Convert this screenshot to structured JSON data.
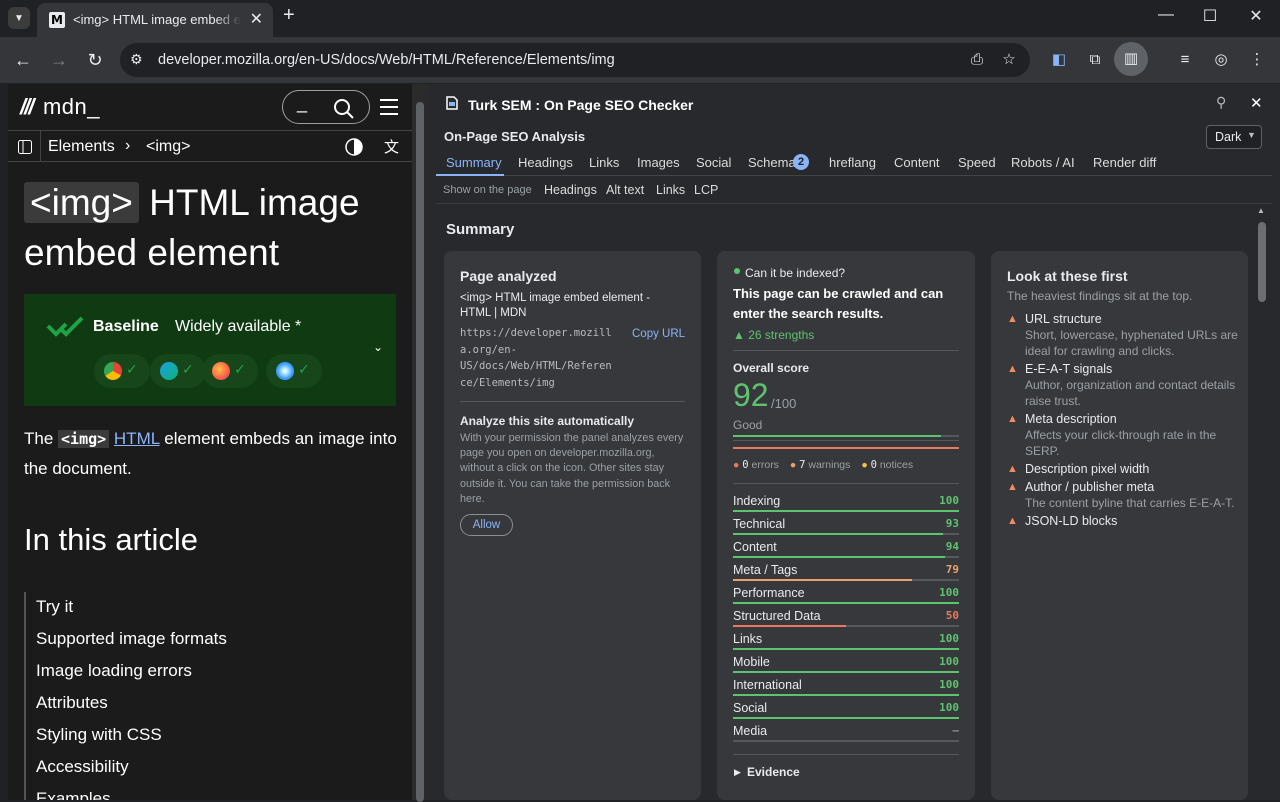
{
  "browser": {
    "tab_title": "<img> HTML image embed element",
    "favicon_letter": "M",
    "url": "developer.mozilla.org/en-US/docs/Web/HTML/Reference/Elements/img"
  },
  "mdn": {
    "logo": "mdn_",
    "breadcrumb": [
      "Elements",
      "<img>"
    ],
    "title_code": "<img>",
    "title_rest": " HTML image embed element",
    "baseline_label": "Baseline",
    "baseline_status": "Widely available *",
    "intro_pre": "The ",
    "intro_code": "<img>",
    "intro_link": "HTML",
    "intro_post": " element embeds an image into the document.",
    "toc_heading": "In this article",
    "toc_items": [
      "Try it",
      "Supported image formats",
      "Image loading errors",
      "Attributes",
      "Styling with CSS",
      "Accessibility",
      "Examples"
    ]
  },
  "panel": {
    "title": "Turk SEM : On Page SEO Checker",
    "subtitle": "On-Page SEO Analysis",
    "theme_select": "Dark",
    "tabs": [
      "Summary",
      "Headings",
      "Links",
      "Images",
      "Social",
      "Schema",
      "hreflang",
      "Content",
      "Speed",
      "Robots / AI",
      "Render diff"
    ],
    "schema_badge": "2",
    "subrow_label": "Show on the page",
    "subrow_items": [
      "Headings",
      "Alt text",
      "Links",
      "LCP"
    ],
    "section_title": "Summary",
    "page_analyzed": {
      "title": "Page analyzed",
      "page_title": "<img> HTML image embed element - HTML | MDN",
      "url": "https://developer.mozilla.org/en-US/docs/Web/HTML/Reference/Elements/img",
      "url_lines": [
        "https://developer.mozill",
        "a.org/en-",
        "US/docs/Web/HTML/Referen",
        "ce/Elements/img"
      ],
      "copy_label": "Copy URL",
      "auto_title": "Analyze this site automatically",
      "auto_desc": "With your permission the panel analyzes every page you open on developer.mozilla.org, without a click on the icon. Other sites stay outside it. You can take the permission back here.",
      "allow_label": "Allow"
    },
    "indexing": {
      "question": "Can it be indexed?",
      "answer": "This page can be crawled and can enter the search results.",
      "strengths": "▲ 26 strengths",
      "score_label": "Overall score",
      "score": "92",
      "score_max": "/100",
      "score_fraction": 0.92,
      "score_word": "Good",
      "errors": "0",
      "errors_label": "errors",
      "warnings": "7",
      "warnings_label": "warnings",
      "notices": "0",
      "notices_label": "notices",
      "metrics": [
        {
          "label": "Indexing",
          "value": "100",
          "pct": 100,
          "color": "#5ec36f"
        },
        {
          "label": "Technical",
          "value": "93",
          "pct": 93,
          "color": "#5ec36f"
        },
        {
          "label": "Content",
          "value": "94",
          "pct": 94,
          "color": "#5ec36f"
        },
        {
          "label": "Meta / Tags",
          "value": "79",
          "pct": 79,
          "color": "#e9a06c"
        },
        {
          "label": "Performance",
          "value": "100",
          "pct": 100,
          "color": "#5ec36f"
        },
        {
          "label": "Structured Data",
          "value": "50",
          "pct": 50,
          "color": "#e9795f"
        },
        {
          "label": "Links",
          "value": "100",
          "pct": 100,
          "color": "#5ec36f"
        },
        {
          "label": "Mobile",
          "value": "100",
          "pct": 100,
          "color": "#5ec36f"
        },
        {
          "label": "International",
          "value": "100",
          "pct": 100,
          "color": "#5ec36f"
        },
        {
          "label": "Social",
          "value": "100",
          "pct": 100,
          "color": "#5ec36f"
        },
        {
          "label": "Media",
          "value": "–",
          "pct": 0,
          "color": "#8a8d91"
        }
      ],
      "evidence": "Evidence"
    },
    "look_first": {
      "title": "Look at these first",
      "subtitle": "The heaviest findings sit at the top.",
      "items": [
        {
          "label": "URL structure",
          "desc": "Short, lowercase, hyphenated URLs are ideal for crawling and clicks."
        },
        {
          "label": "E-E-A-T signals",
          "desc": "Author, organization and contact details raise trust."
        },
        {
          "label": "Meta description",
          "desc": "Affects your click-through rate in the SERP."
        },
        {
          "label": "Description pixel width",
          "desc": ""
        },
        {
          "label": "Author / publisher meta",
          "desc": "The content byline that carries E-E-A-T."
        },
        {
          "label": "JSON-LD blocks",
          "desc": ""
        }
      ]
    }
  },
  "colors": {
    "accent": "#8ab4f8",
    "good": "#5ec36f",
    "warn": "#e9a06c",
    "bad": "#e9795f",
    "baseline_bg": "#0f3a12"
  }
}
